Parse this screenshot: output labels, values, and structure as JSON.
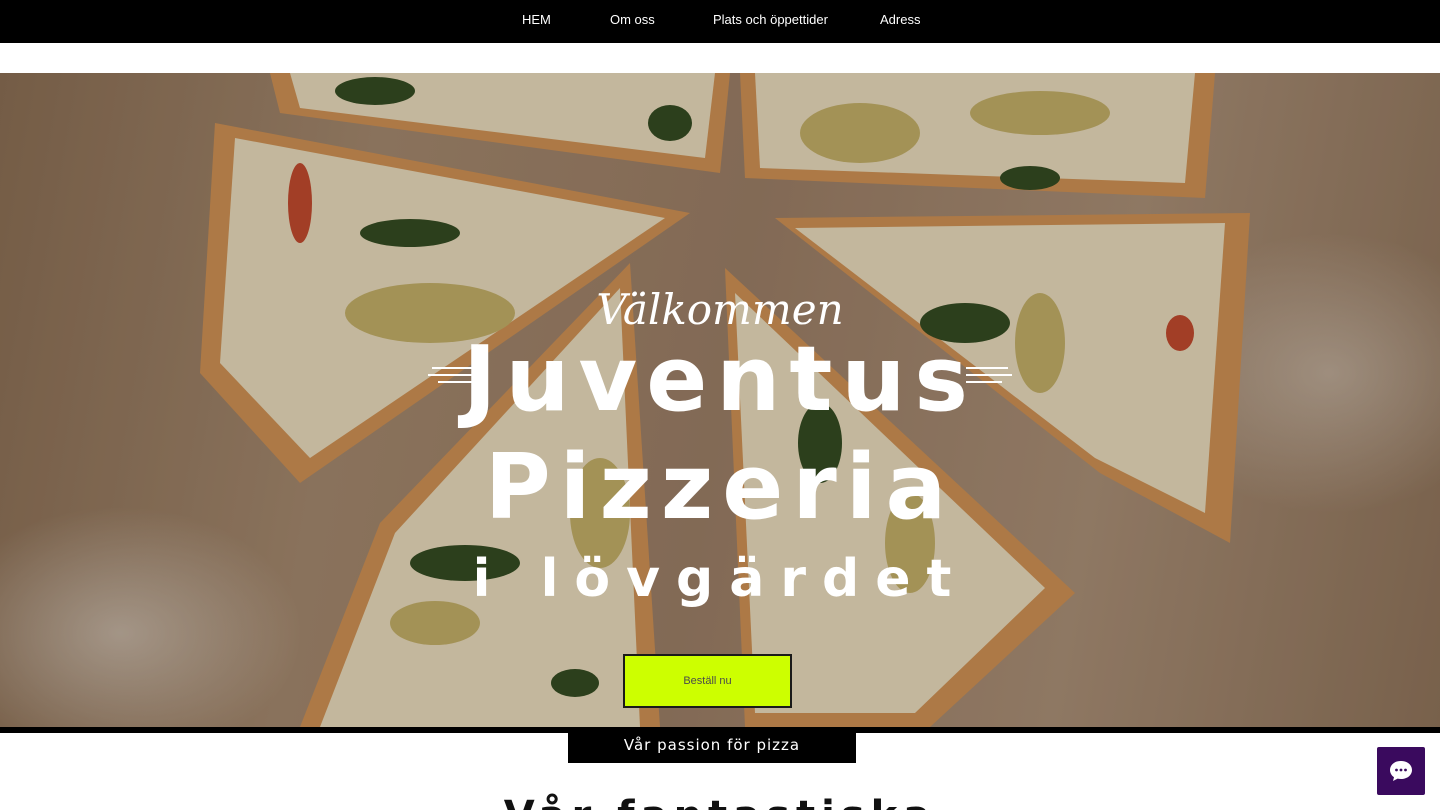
{
  "nav": {
    "items": [
      {
        "label": "HEM"
      },
      {
        "label": "Om oss"
      },
      {
        "label": "Plats och öppettider"
      },
      {
        "label": "Adress"
      }
    ]
  },
  "hero": {
    "welcome": "Välkommen",
    "title_line1": "Juventus",
    "title_line2": "Pizzeria",
    "subtitle": "i lövgärdet",
    "cta_label": "Beställ nu"
  },
  "section": {
    "tab_label": "Vår passion för pizza",
    "heading_partial": "Vår fantastiska"
  },
  "chat": {
    "icon": "chat-bubble-icon"
  },
  "colors": {
    "nav_bg": "#000000",
    "cta_bg": "#cdff00",
    "chat_bg": "#3a0a5e"
  }
}
